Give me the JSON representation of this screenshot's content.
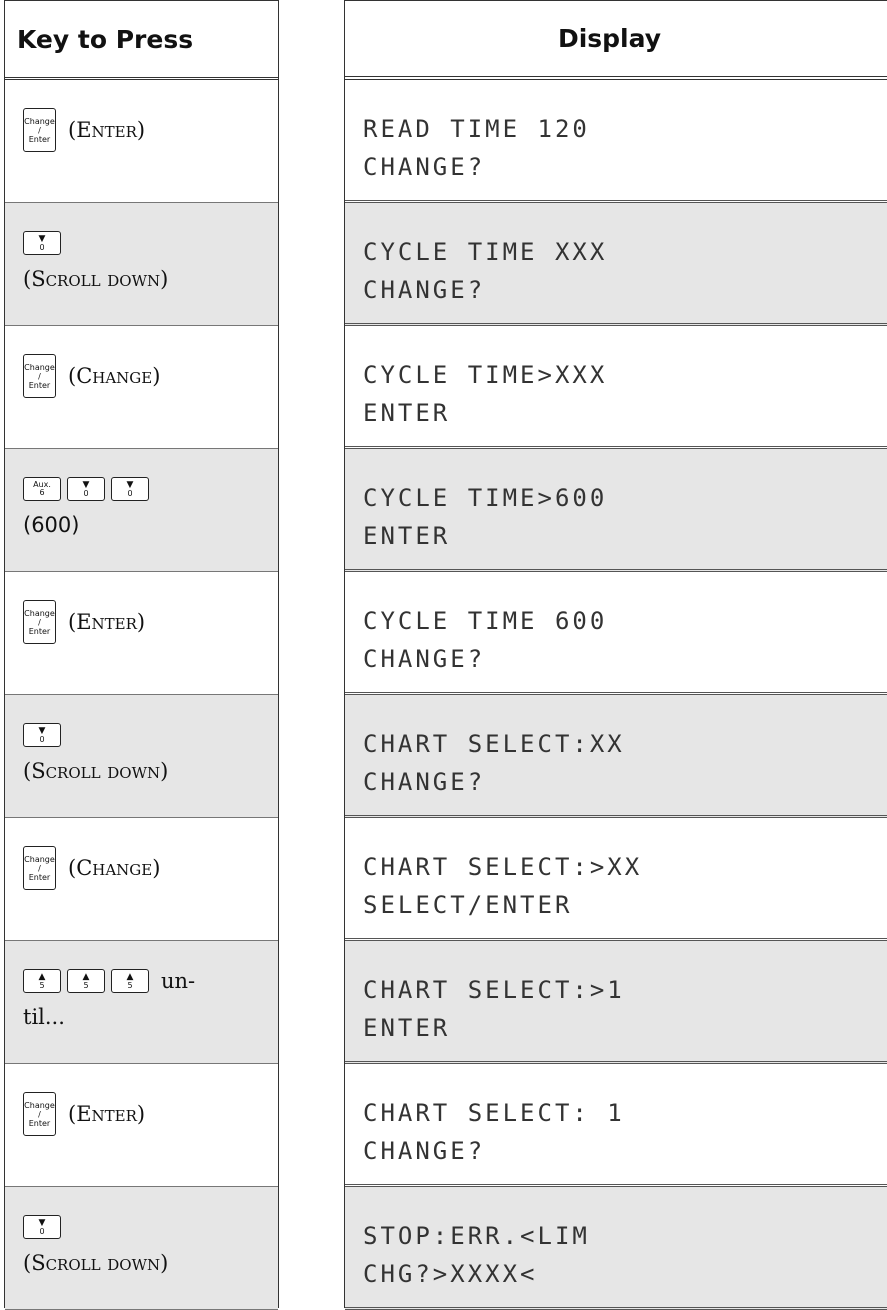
{
  "headers": {
    "keys": "Key to Press",
    "display": "Display"
  },
  "caps": {
    "change_enter": {
      "top": "Change",
      "mid": "/",
      "bottom": "Enter"
    },
    "down_arrow": {
      "glyph": "▼",
      "digit": "0"
    },
    "up_arrow": {
      "glyph": "▲",
      "digit": "5"
    },
    "aux6": {
      "top": "Aux.",
      "digit": "6"
    }
  },
  "rows": [
    {
      "key_label": "(Enter)",
      "display": [
        "READ TIME 120",
        "CHANGE?"
      ]
    },
    {
      "key_label": "(Scroll down)",
      "display": [
        "CYCLE TIME XXX",
        "CHANGE?"
      ]
    },
    {
      "key_label": "(Change)",
      "display": [
        "CYCLE TIME>XXX",
        "ENTER"
      ]
    },
    {
      "key_label": "(600)",
      "display": [
        "CYCLE TIME>600",
        "ENTER"
      ]
    },
    {
      "key_label": "(Enter)",
      "display": [
        "CYCLE TIME 600",
        "CHANGE?"
      ]
    },
    {
      "key_label": "(Scroll down)",
      "display": [
        "CHART SELECT:XX",
        "CHANGE?"
      ]
    },
    {
      "key_label": "(Change)",
      "display": [
        "CHART SELECT:>XX",
        "SELECT/ENTER"
      ]
    },
    {
      "key_label": "un-",
      "key_label_2": "til...",
      "display": [
        "CHART SELECT:>1",
        "ENTER"
      ]
    },
    {
      "key_label": "(Enter)",
      "display": [
        "CHART SELECT: 1",
        "CHANGE?"
      ]
    },
    {
      "key_label": "(Scroll down)",
      "display": [
        "STOP:ERR.<LIM",
        "CHG?>XXXX<"
      ]
    }
  ]
}
